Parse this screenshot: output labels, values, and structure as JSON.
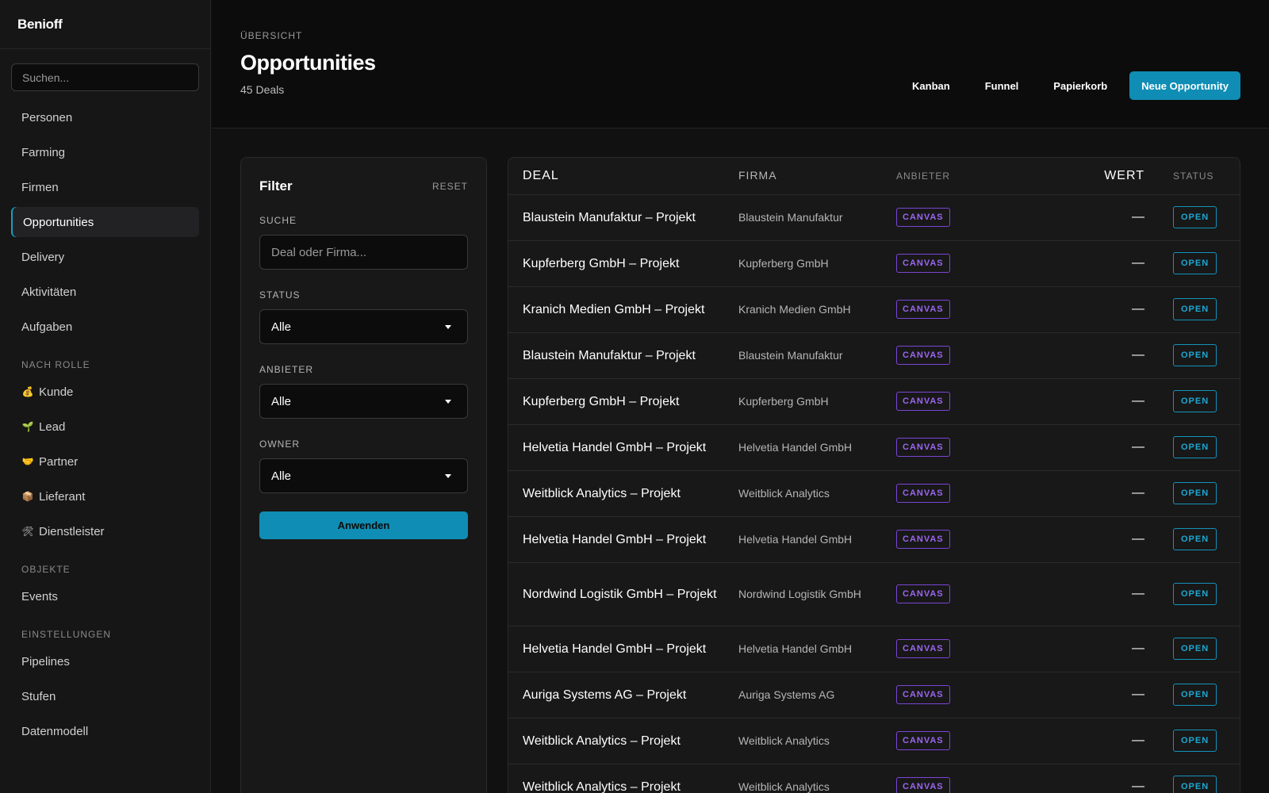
{
  "sidebar": {
    "brand": "Benioff",
    "search_placeholder": "Suchen...",
    "main_items": [
      "Personen",
      "Farming",
      "Firmen",
      "Opportunities",
      "Delivery",
      "Aktivitäten",
      "Aufgaben"
    ],
    "active_item": "Opportunities",
    "section_rolle": "NACH ROLLE",
    "rolle_items": [
      {
        "emoji": "💰",
        "label": "Kunde"
      },
      {
        "emoji": "🌱",
        "label": "Lead"
      },
      {
        "emoji": "🤝",
        "label": "Partner"
      },
      {
        "emoji": "📦",
        "label": "Lieferant"
      },
      {
        "emoji": "🛠",
        "label": "Dienstleister"
      }
    ],
    "section_objekte": "OBJEKTE",
    "objekte_items": [
      "Events"
    ],
    "section_einstellungen": "EINSTELLUNGEN",
    "einstellungen_items": [
      "Pipelines",
      "Stufen",
      "Datenmodell"
    ]
  },
  "header": {
    "breadcrumb": "ÜBERSICHT",
    "title": "Opportunities",
    "subtitle": "45 Deals",
    "actions": {
      "kanban": "Kanban",
      "funnel": "Funnel",
      "papierkorb": "Papierkorb",
      "new": "Neue Opportunity"
    }
  },
  "filter": {
    "title": "Filter",
    "reset": "RESET",
    "search_label": "SUCHE",
    "search_placeholder": "Deal oder Firma...",
    "status_label": "STATUS",
    "status_value": "Alle",
    "anbieter_label": "ANBIETER",
    "anbieter_value": "Alle",
    "owner_label": "OWNER",
    "owner_value": "Alle",
    "apply": "Anwenden"
  },
  "table": {
    "columns": {
      "deal": "DEAL",
      "firma": "FIRMA",
      "anbieter": "ANBIETER",
      "wert": "WERT",
      "status": "STATUS"
    },
    "rows": [
      {
        "deal": "Blaustein Manufaktur – Projekt",
        "firma": "Blaustein Manufaktur",
        "anbieter": "CANVAS",
        "wert": "—",
        "status": "OPEN"
      },
      {
        "deal": "Kupferberg GmbH – Projekt",
        "firma": "Kupferberg GmbH",
        "anbieter": "CANVAS",
        "wert": "—",
        "status": "OPEN"
      },
      {
        "deal": "Kranich Medien GmbH – Projekt",
        "firma": "Kranich Medien GmbH",
        "anbieter": "CANVAS",
        "wert": "—",
        "status": "OPEN"
      },
      {
        "deal": "Blaustein Manufaktur – Projekt",
        "firma": "Blaustein Manufaktur",
        "anbieter": "CANVAS",
        "wert": "—",
        "status": "OPEN"
      },
      {
        "deal": "Kupferberg GmbH – Projekt",
        "firma": "Kupferberg GmbH",
        "anbieter": "CANVAS",
        "wert": "—",
        "status": "OPEN"
      },
      {
        "deal": "Helvetia Handel GmbH – Projekt",
        "firma": "Helvetia Handel GmbH",
        "anbieter": "CANVAS",
        "wert": "—",
        "status": "OPEN"
      },
      {
        "deal": "Weitblick Analytics – Projekt",
        "firma": "Weitblick Analytics",
        "anbieter": "CANVAS",
        "wert": "—",
        "status": "OPEN"
      },
      {
        "deal": "Helvetia Handel GmbH – Projekt",
        "firma": "Helvetia Handel GmbH",
        "anbieter": "CANVAS",
        "wert": "—",
        "status": "OPEN"
      },
      {
        "deal": "Nordwind Logistik GmbH – Projekt",
        "firma": "Nordwind Logistik GmbH",
        "anbieter": "CANVAS",
        "wert": "—",
        "status": "OPEN"
      },
      {
        "deal": "Helvetia Handel GmbH – Projekt",
        "firma": "Helvetia Handel GmbH",
        "anbieter": "CANVAS",
        "wert": "—",
        "status": "OPEN"
      },
      {
        "deal": "Auriga Systems AG – Projekt",
        "firma": "Auriga Systems AG",
        "anbieter": "CANVAS",
        "wert": "—",
        "status": "OPEN"
      },
      {
        "deal": "Weitblick Analytics – Projekt",
        "firma": "Weitblick Analytics",
        "anbieter": "CANVAS",
        "wert": "—",
        "status": "OPEN"
      },
      {
        "deal": "Weitblick Analytics – Projekt",
        "firma": "Weitblick Analytics",
        "anbieter": "CANVAS",
        "wert": "—",
        "status": "OPEN"
      }
    ]
  }
}
